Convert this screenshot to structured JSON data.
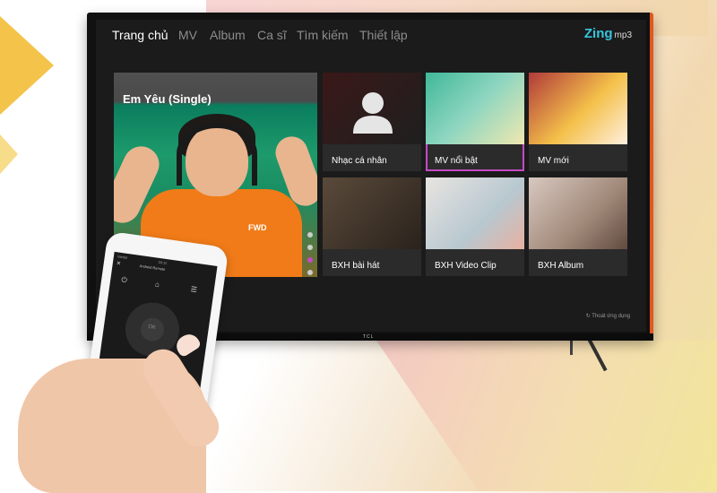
{
  "nav": {
    "items": [
      "Trang chủ",
      "MV",
      "Album",
      "Ca sĩ",
      "Tìm kiếm",
      "Thiết lập"
    ],
    "active_index": 0
  },
  "logo": {
    "brand": "Zing",
    "suffix": "mp3"
  },
  "featured": {
    "title": "Em Yêu (Single)",
    "shirt_text": "FWD",
    "carousel_dots": 4,
    "active_dot": 3
  },
  "tiles": [
    {
      "label": "Nhạc cá nhân",
      "icon": "person-silhouette-icon",
      "selected": false
    },
    {
      "label": "MV nổi bật",
      "selected": true
    },
    {
      "label": "MV mới",
      "selected": false
    },
    {
      "label": "BXH bài hát",
      "selected": false
    },
    {
      "label": "BXH Video Clip",
      "selected": false
    },
    {
      "label": "BXH Album",
      "selected": false
    }
  ],
  "footer": {
    "exit_label": "Thoát ứng dụng"
  },
  "tv_brand": "TCL",
  "phone": {
    "status": "Viettel",
    "time": "16:11",
    "title": "Android Remote",
    "ok_label": "OK"
  },
  "colors": {
    "accent": "#c64ac6",
    "logo": "#36c6e0",
    "screen_bg": "#1b1b1b",
    "tv_edge": "#e2571e"
  }
}
